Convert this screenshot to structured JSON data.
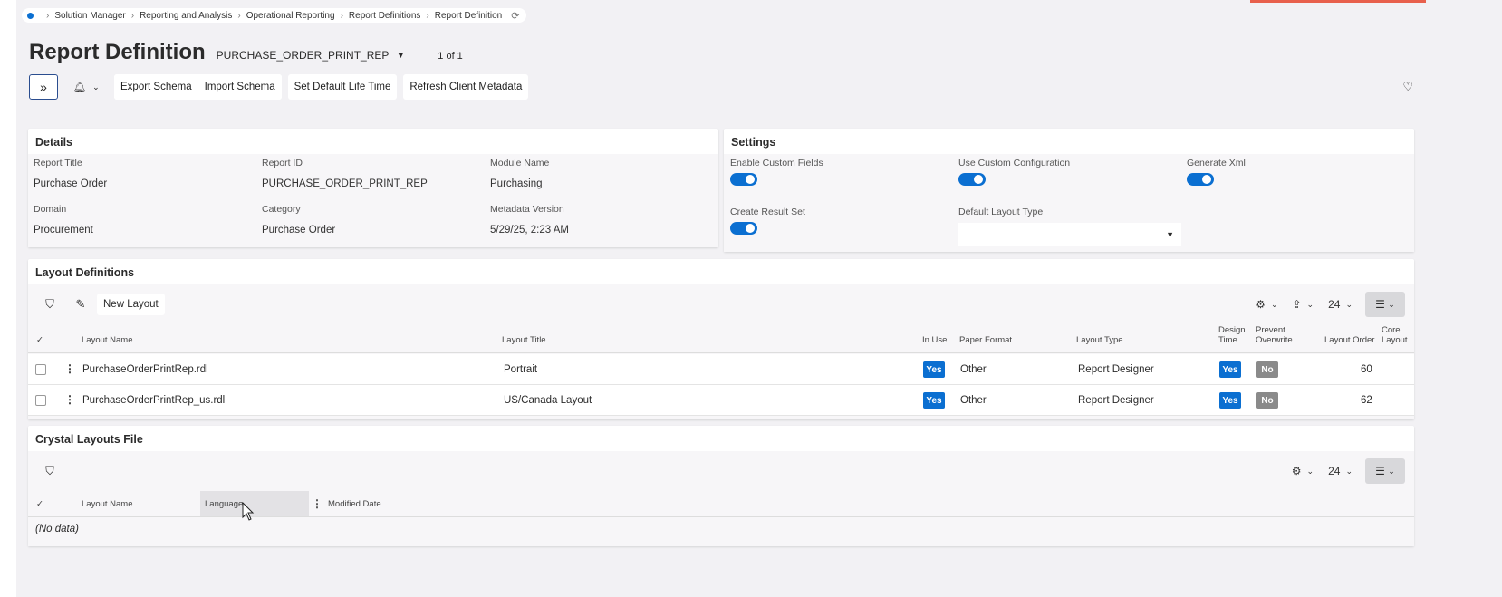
{
  "breadcrumb": [
    "Solution Manager",
    "Reporting and Analysis",
    "Operational Reporting",
    "Report Definitions",
    "Report Definition"
  ],
  "page": {
    "title": "Report Definition",
    "record_key": "PURCHASE_ORDER_PRINT_REP",
    "record_count": "1 of 1"
  },
  "toolbar": {
    "export_schema": "Export Schema",
    "import_schema": "Import Schema",
    "set_default_life_time": "Set Default Life Time",
    "refresh_client_metadata": "Refresh Client Metadata"
  },
  "details": {
    "title": "Details",
    "report_title_label": "Report Title",
    "report_title": "Purchase Order",
    "report_id_label": "Report ID",
    "report_id": "PURCHASE_ORDER_PRINT_REP",
    "module_name_label": "Module Name",
    "module_name": "Purchasing",
    "domain_label": "Domain",
    "domain": "Procurement",
    "category_label": "Category",
    "category": "Purchase Order",
    "metadata_version_label": "Metadata Version",
    "metadata_version": "5/29/25, 2:23 AM"
  },
  "settings": {
    "title": "Settings",
    "enable_custom_fields_label": "Enable Custom Fields",
    "enable_custom_fields": true,
    "use_custom_configuration_label": "Use Custom Configuration",
    "use_custom_configuration": true,
    "generate_xml_label": "Generate Xml",
    "generate_xml": true,
    "create_result_set_label": "Create Result Set",
    "create_result_set": true,
    "default_layout_type_label": "Default Layout Type",
    "default_layout_type": ""
  },
  "layouts": {
    "title": "Layout Definitions",
    "new_layout": "New Layout",
    "page_size": "24",
    "columns": {
      "layout_name": "Layout Name",
      "layout_title": "Layout Title",
      "in_use": "In Use",
      "paper_format": "Paper Format",
      "layout_type": "Layout Type",
      "design_time_1": "Design",
      "design_time_2": "Time",
      "prevent_overwrite_1": "Prevent",
      "prevent_overwrite_2": "Overwrite",
      "layout_order": "Layout Order",
      "core_layout_1": "Core",
      "core_layout_2": "Layout"
    },
    "rows": [
      {
        "name": "PurchaseOrderPrintRep.rdl",
        "title": "Portrait",
        "in_use": "Yes",
        "paper_format": "Other",
        "layout_type": "Report Designer",
        "design_time": "Yes",
        "prevent_overwrite": "No",
        "order": "60"
      },
      {
        "name": "PurchaseOrderPrintRep_us.rdl",
        "title": "US/Canada Layout",
        "in_use": "Yes",
        "paper_format": "Other",
        "layout_type": "Report Designer",
        "design_time": "Yes",
        "prevent_overwrite": "No",
        "order": "62"
      }
    ]
  },
  "crystal": {
    "title": "Crystal Layouts File",
    "page_size": "24",
    "columns": {
      "layout_name": "Layout Name",
      "language": "Language",
      "modified_date": "Modified Date"
    },
    "no_data": "(No data)"
  },
  "colors": {
    "accent": "#0b6fd1",
    "top_accent": "#e8604c",
    "no_badge": "#8a8a8a"
  }
}
